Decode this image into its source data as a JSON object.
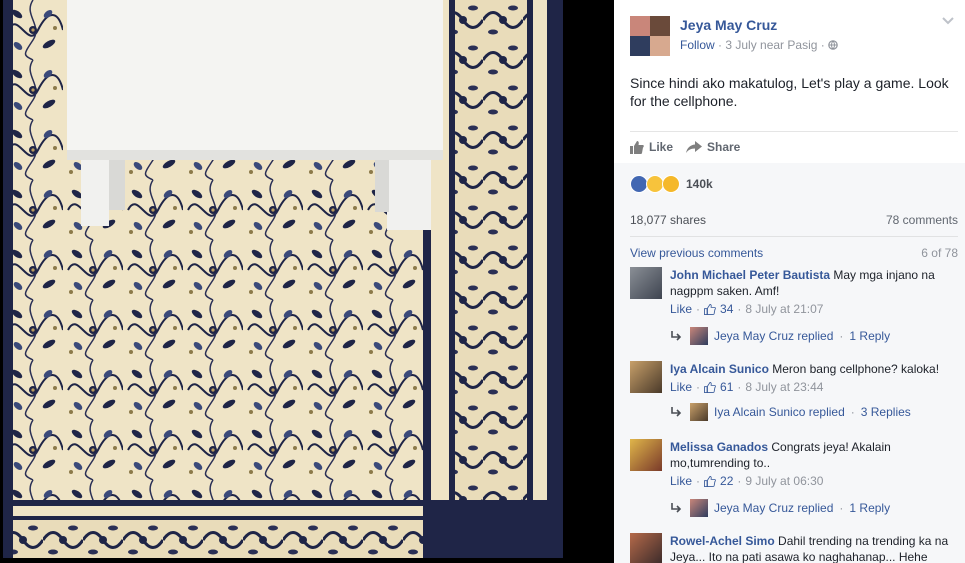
{
  "post": {
    "author": "Jeya May Cruz",
    "follow": "Follow",
    "meta_rest": " · 3 July near Pasig · ",
    "text": "Since hindi ako makatulog, Let's play a game. Look for the cellphone."
  },
  "actions": {
    "like": "Like",
    "share": "Share"
  },
  "feedback": {
    "reaction_count": "140k",
    "shares": "18,077 shares",
    "comments": "78 comments",
    "view_previous": "View previous comments",
    "pager": "6 of 78"
  },
  "comments": [
    {
      "name": "John Michael Peter Bautista",
      "text": " May mga injano na nagppm saken. Amf!",
      "like": "Like",
      "likes": "34",
      "time": "8 July at 21:07",
      "reply_by": "Jeya May Cruz replied",
      "reply_count": "1 Reply"
    },
    {
      "name": "Iya Alcain Sunico",
      "text": " Meron bang cellphone? kaloka!",
      "like": "Like",
      "likes": "61",
      "time": "8 July at 23:44",
      "reply_by": "Iya Alcain Sunico replied",
      "reply_count": "3 Replies"
    },
    {
      "name": "Melissa Ganados",
      "text": " Congrats jeya! Akalain mo,tumrending to..",
      "like": "Like",
      "likes": "22",
      "time": "9 July at 06:30",
      "reply_by": "Jeya May Cruz replied",
      "reply_count": "1 Reply"
    },
    {
      "name": "Rowel-Achel Simo",
      "text": " Dahil trending na trending ka na Jeya... Ito na pati asawa ko naghahanap... Hehe"
    }
  ],
  "colors": {
    "link": "#365899",
    "muted": "#90949c",
    "rug_base": "#efe4c6",
    "rug_navy": "#1f2547"
  },
  "icons": [
    "like-icon",
    "share-icon",
    "globe-icon",
    "chevron-down-icon",
    "reply-arrow-icon",
    "thumb-up-small-icon"
  ]
}
